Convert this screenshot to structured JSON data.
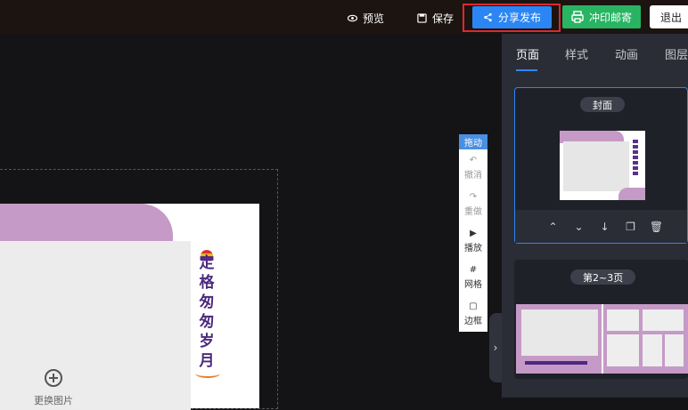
{
  "topbar": {
    "preview_label": "预览",
    "save_label": "保存",
    "share_label": "分享发布",
    "print_label": "冲印邮寄",
    "exit_label": "退出"
  },
  "canvas": {
    "replace_image_label": "更换图片",
    "cover_title": "定格匆匆岁月"
  },
  "toolbox": {
    "drag_label": "拖动",
    "items": [
      {
        "icon": "↶",
        "label": "撤消"
      },
      {
        "icon": "↷",
        "label": "重做"
      },
      {
        "icon": "▶",
        "label": "播放"
      },
      {
        "icon": "#",
        "label": "网格"
      },
      {
        "icon": "▢",
        "label": "边框"
      }
    ]
  },
  "sidebar": {
    "tabs": [
      {
        "label": "页面"
      },
      {
        "label": "样式"
      },
      {
        "label": "动画"
      },
      {
        "label": "图层"
      }
    ],
    "pages": [
      {
        "label": "封面"
      },
      {
        "label": "第2~3页"
      }
    ],
    "page_actions": [
      "⌃",
      "⌄",
      "↓",
      "❐",
      "🗑"
    ],
    "collapse_icon": "›"
  },
  "colors": {
    "accent": "#2b86f4",
    "print_green": "#28b463",
    "highlight_red": "#e0282d",
    "template_purple": "#c59ac6"
  }
}
